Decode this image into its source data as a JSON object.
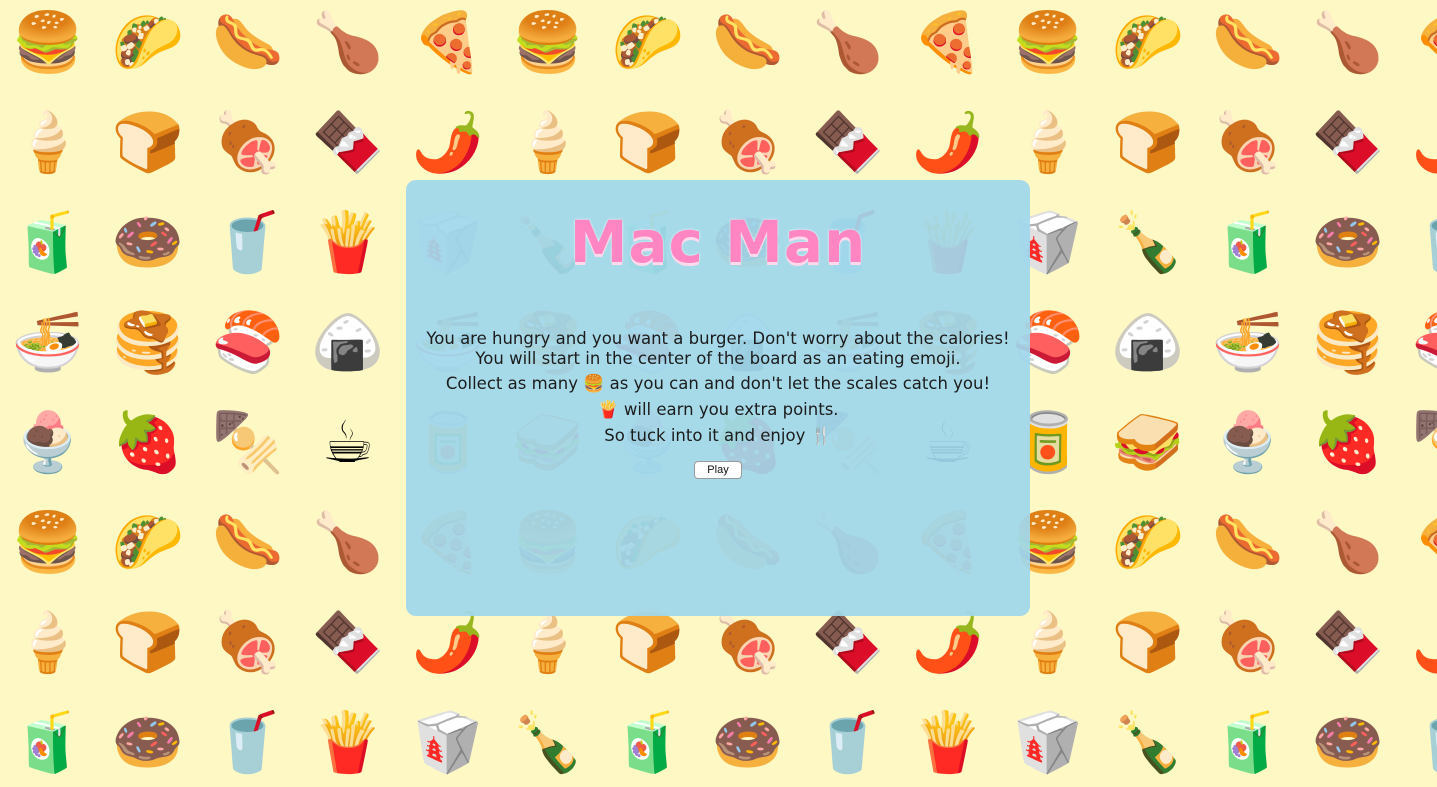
{
  "background": {
    "color": "#fdf8c4",
    "rows": [
      [
        "🍔",
        "🌮",
        "🌭",
        "🍗",
        "🍕",
        "🍔",
        "🌮",
        "🌭",
        "🍗",
        "🍕",
        "🍔",
        "🌮",
        "🌭",
        "🍗",
        "🍕"
      ],
      [
        "🍦",
        "🍞",
        "🍖",
        "🍫",
        "🌶️",
        "🍦",
        "🍞",
        "🍖",
        "🍫",
        "🌶️",
        "🍦",
        "🍞",
        "🍖",
        "🍫",
        "🌶️"
      ],
      [
        "🧃",
        "🍩",
        "🥤",
        "🍟",
        "🥡",
        "🍾",
        "🧃",
        "🍩",
        "🥤",
        "🍟",
        "🥡",
        "🍾",
        "🧃",
        "🍩",
        "🥤"
      ],
      [
        "🍜",
        "🥞",
        "🍣",
        "🍙",
        "🍜",
        "🥞",
        "🍣",
        "🍙",
        "🍜",
        "🥞",
        "🍣",
        "🍙",
        "🍜",
        "🥞",
        "🍣"
      ],
      [
        "🍨",
        "🍓",
        "🍢",
        "☕",
        "🥫",
        "🥪",
        "🍨",
        "🍓",
        "🍢",
        "☕",
        "🥫",
        "🥪",
        "🍨",
        "🍓",
        "🍢"
      ],
      [
        "🍔",
        "🌮",
        "🌭",
        "🍗",
        "🍕",
        "🍔",
        "🌮",
        "🌭",
        "🍗",
        "🍕",
        "🍔",
        "🌮",
        "🌭",
        "🍗",
        "🍕"
      ],
      [
        "🍦",
        "🍞",
        "🍖",
        "🍫",
        "🌶️",
        "🍦",
        "🍞",
        "🍖",
        "🍫",
        "🌶️",
        "🍦",
        "🍞",
        "🍖",
        "🍫",
        "🌶️"
      ],
      [
        "🧃",
        "🍩",
        "🥤",
        "🍟",
        "🥡",
        "🍾",
        "🧃",
        "🍩",
        "🥤",
        "🍟",
        "🥡",
        "🍾",
        "🧃",
        "🍩",
        "🥤"
      ]
    ]
  },
  "modal": {
    "background": "#a0d7ec",
    "title": "Mac Man",
    "title_color": "#ff86c2",
    "line1": "You are hungry and you want a burger. Don't worry about the calories!",
    "line2": "You will start in the center of the board as an eating emoji.",
    "line3_before": "Collect as many ",
    "line3_emoji": "🍔",
    "line3_after": " as you can and don't let the scales catch you!",
    "line4_emoji": "🍟",
    "line4_after": " will earn you extra points.",
    "line5_before": "So tuck into it and enjoy ",
    "line5_emoji": "🍴",
    "play_label": "Play"
  }
}
